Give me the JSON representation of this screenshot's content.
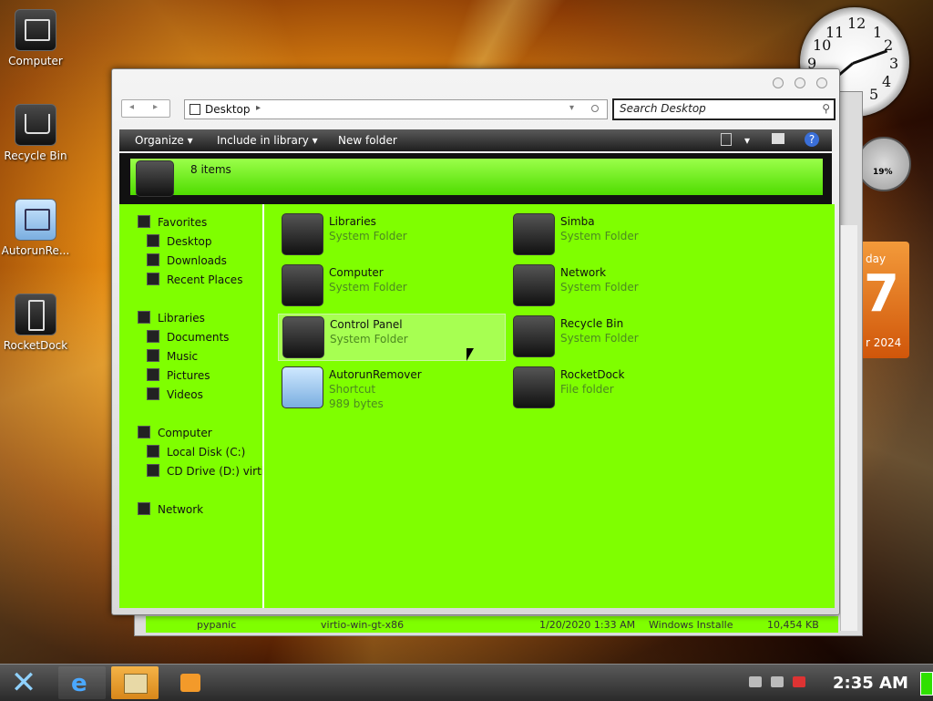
{
  "desktop": {
    "icons": [
      {
        "label": "Computer"
      },
      {
        "label": "Recycle Bin"
      },
      {
        "label": "AutorunRe..."
      },
      {
        "label": "RocketDock"
      }
    ]
  },
  "widgets": {
    "clock_numbers": [
      "12",
      "1",
      "2",
      "3",
      "4",
      "5",
      "9",
      "10",
      "11"
    ],
    "gauge_text": "19%",
    "calendar": {
      "day_name": "day",
      "day_num": "7",
      "month_year": "r 2024"
    }
  },
  "window": {
    "address": "Desktop",
    "search_placeholder": "Search Desktop",
    "toolbar": {
      "organize": "Organize ▾",
      "include": "Include in library ▾",
      "new_folder": "New folder"
    },
    "header": {
      "count": "8 items"
    },
    "nav": {
      "favorites": "Favorites",
      "desktop": "Desktop",
      "downloads": "Downloads",
      "recent": "Recent Places",
      "libraries": "Libraries",
      "documents": "Documents",
      "music": "Music",
      "pictures": "Pictures",
      "videos": "Videos",
      "computer": "Computer",
      "local_disk": "Local Disk (C:)",
      "cd_drive": "CD Drive (D:) virtio-w",
      "network": "Network"
    },
    "items": [
      {
        "name": "Libraries",
        "sub": "System Folder",
        "sub2": ""
      },
      {
        "name": "Simba",
        "sub": "System Folder",
        "sub2": ""
      },
      {
        "name": "Computer",
        "sub": "System Folder",
        "sub2": ""
      },
      {
        "name": "Network",
        "sub": "System Folder",
        "sub2": ""
      },
      {
        "name": "Control Panel",
        "sub": "System Folder",
        "sub2": ""
      },
      {
        "name": "Recycle Bin",
        "sub": "System Folder",
        "sub2": ""
      },
      {
        "name": "AutorunRemover",
        "sub": "Shortcut",
        "sub2": "989 bytes"
      },
      {
        "name": "RocketDock",
        "sub": "File folder",
        "sub2": ""
      }
    ]
  },
  "back_window": {
    "row_name": "pypanic",
    "row_file": "virtio-win-gt-x86",
    "row_date": "1/20/2020 1:33 AM",
    "row_type": "Windows Installe",
    "row_size": "10,454 KB"
  },
  "taskbar": {
    "time": "2:35 AM"
  },
  "colors": {
    "content_bg": "#7fff00",
    "header_bar": "#5fe800",
    "accent_blue": "#8fd1ff"
  }
}
